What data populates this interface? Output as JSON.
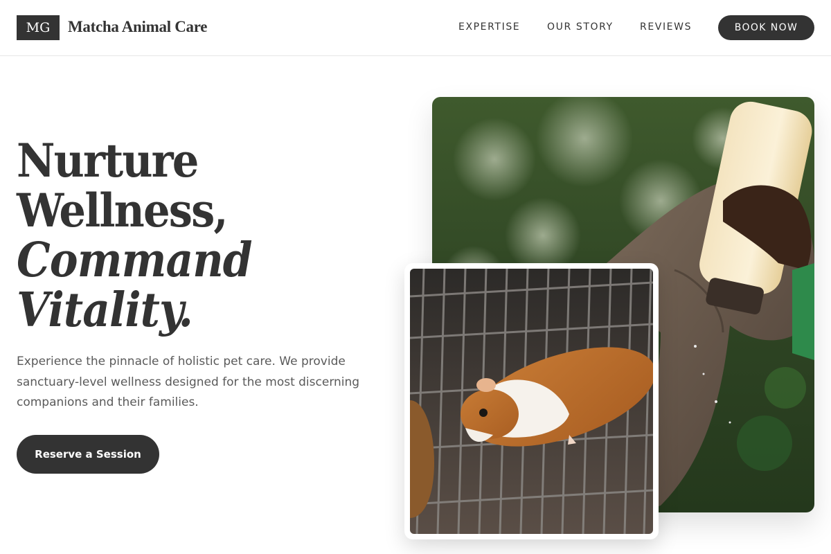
{
  "brand": {
    "logo_mark": "MG",
    "name": "Matcha Animal Care"
  },
  "nav": {
    "links": [
      "EXPERTISE",
      "OUR STORY",
      "REVIEWS"
    ],
    "cta": "BOOK NOW"
  },
  "hero": {
    "title_lines": [
      "Nurture",
      "Wellness,",
      "Command",
      "Vitality."
    ],
    "description": "Experience the pinnacle of holistic pet care. We provide sanctuary-level wellness designed for the most discerning companions and their families.",
    "cta": "Reserve a Session"
  },
  "images": {
    "large": "elephant-bottle-feeding-photo",
    "small": "guinea-pig-on-cage-photo"
  },
  "colors": {
    "primary": "#333333",
    "text_muted": "#5a5a5a",
    "background": "#ffffff"
  }
}
